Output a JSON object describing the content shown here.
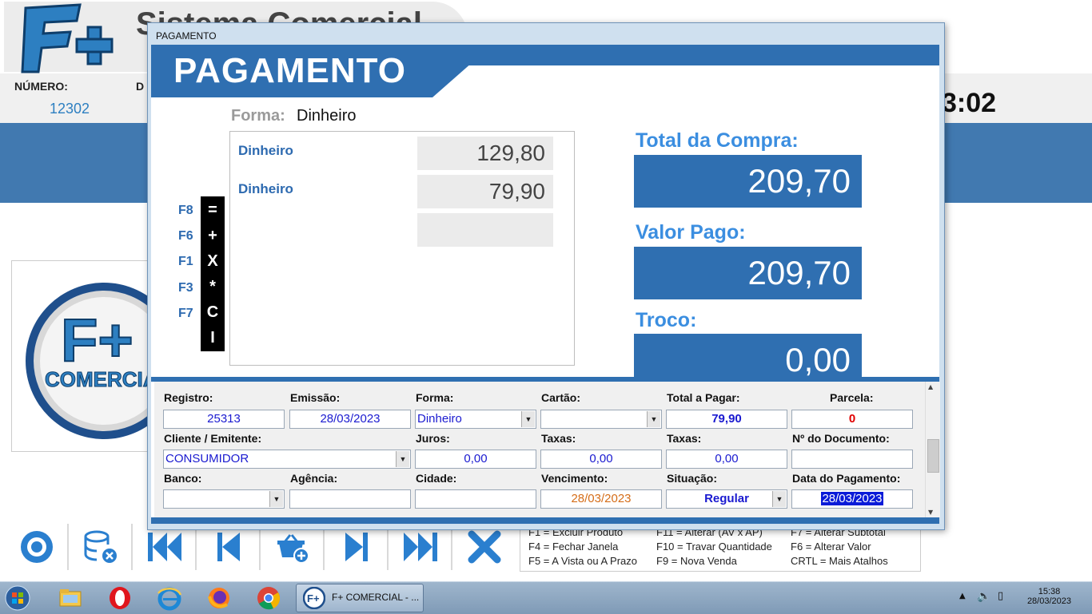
{
  "background": {
    "app_title": "Sistema Comercial",
    "numero_label": "NÚMERO:",
    "numero_value": "12302",
    "data_label": "D",
    "clock": "3:02",
    "logo_text": "COMERCIAL"
  },
  "shortcuts": [
    [
      "F1 = Excluir Produto",
      "F11 = Alterar (AV x AP)",
      "F7 = Alterar Subtotal"
    ],
    [
      "F4 = Fechar Janela",
      "F10 = Travar Quantidade",
      "F6 = Alterar Valor"
    ],
    [
      "F5 = A Vista ou A Prazo",
      "F9 = Nova Venda",
      "CRTL = Mais Atalhos"
    ]
  ],
  "modal": {
    "caption": "PAGAMENTO",
    "banner": "PAGAMENTO",
    "forma_label": "Forma:",
    "forma_value": "Dinheiro",
    "payments": [
      {
        "name": "Dinheiro",
        "amount": "129,80"
      },
      {
        "name": "Dinheiro",
        "amount": "79,90"
      },
      {
        "name": "",
        "amount": ""
      }
    ],
    "fkeys": [
      {
        "key": "F8",
        "symbol": "="
      },
      {
        "key": "F6",
        "symbol": "+"
      },
      {
        "key": "F1",
        "symbol": "X"
      },
      {
        "key": "F3",
        "symbol": "*"
      },
      {
        "key": "F7",
        "symbol": "C"
      },
      {
        "key": "",
        "symbol": "I"
      }
    ],
    "total_compra_label": "Total da Compra:",
    "total_compra": "209,70",
    "valor_pago_label": "Valor Pago:",
    "valor_pago": "209,70",
    "troco_label": "Troco:",
    "troco": "0,00"
  },
  "detail": {
    "registro_label": "Registro:",
    "registro": "25313",
    "emissao_label": "Emissão:",
    "emissao": "28/03/2023",
    "forma_label": "Forma:",
    "forma": "Dinheiro",
    "cartao_label": "Cartão:",
    "cartao": "",
    "total_pagar_label": "Total a Pagar:",
    "total_pagar": "79,90",
    "parcela_label": "Parcela:",
    "parcela": "0",
    "cliente_label": "Cliente / Emitente:",
    "cliente": "CONSUMIDOR",
    "juros_label": "Juros:",
    "juros": "0,00",
    "taxas1_label": "Taxas:",
    "taxas1": "0,00",
    "taxas2_label": "Taxas:",
    "taxas2": "0,00",
    "ndoc_label": "Nº do Documento:",
    "ndoc": "",
    "banco_label": "Banco:",
    "banco": "",
    "agencia_label": "Agência:",
    "agencia": "",
    "cidade_label": "Cidade:",
    "cidade": "",
    "vencimento_label": "Vencimento:",
    "vencimento": "28/03/2023",
    "situacao_label": "Situação:",
    "situacao": "Regular",
    "data_pag_label": "Data do Pagamento:",
    "data_pag": "28/03/2023"
  },
  "taskbar": {
    "task_label": "F+ COMERCIAL - ...",
    "time": "15:38",
    "date": "28/03/2023"
  },
  "colors": {
    "brand_blue": "#2f6fb1",
    "label_blue": "#3b8ee0",
    "field_blue_text": "#1a1ad0"
  }
}
